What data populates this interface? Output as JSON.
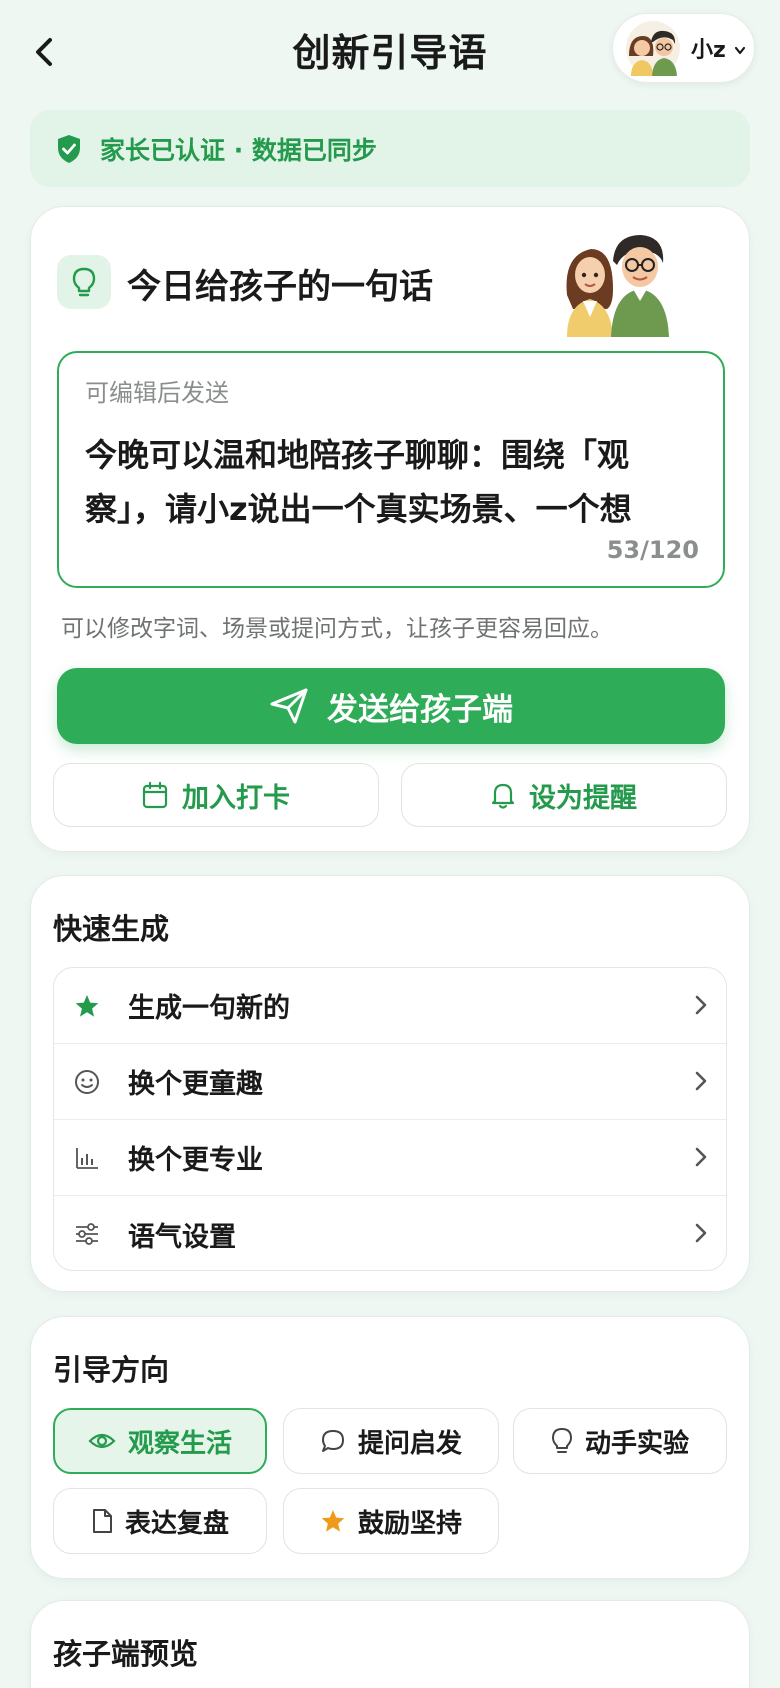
{
  "header": {
    "title": "创新引导语",
    "profile_name": "小z"
  },
  "verified_banner": {
    "text": "家长已认证 · 数据已同步"
  },
  "message_card": {
    "title": "今日给孩子的一句话",
    "edit_hint": "可编辑后发送",
    "message_text": "今晚可以温和地陪孩子聊聊：围绕「观察」，请小z说出一个真实场景、一个想",
    "char_count": "53/120",
    "helper_text": "可以修改字词、场景或提问方式，让孩子更容易回应。",
    "send_label": "发送给孩子端",
    "checkin_label": "加入打卡",
    "reminder_label": "设为提醒"
  },
  "quick_generate": {
    "title": "快速生成",
    "items": [
      {
        "label": "生成一句新的",
        "icon": "star-icon"
      },
      {
        "label": "换个更童趣",
        "icon": "smiley-icon"
      },
      {
        "label": "换个更专业",
        "icon": "bar-chart-icon"
      },
      {
        "label": "语气设置",
        "icon": "sliders-icon"
      }
    ]
  },
  "guide_direction": {
    "title": "引导方向",
    "chips": [
      {
        "label": "观察生活",
        "icon": "eye-icon",
        "active": true
      },
      {
        "label": "提问启发",
        "icon": "chat-bubble-icon",
        "active": false
      },
      {
        "label": "动手实验",
        "icon": "bulb-icon",
        "active": false
      },
      {
        "label": "表达复盘",
        "icon": "document-icon",
        "active": false
      },
      {
        "label": "鼓励坚持",
        "icon": "star-icon",
        "active": false
      }
    ]
  },
  "child_preview": {
    "title": "孩子端预览"
  },
  "colors": {
    "brand_green": "#2eac58",
    "brand_green_text": "#249a4d",
    "background": "#eef7f1",
    "star_orange": "#ef9a1a"
  }
}
